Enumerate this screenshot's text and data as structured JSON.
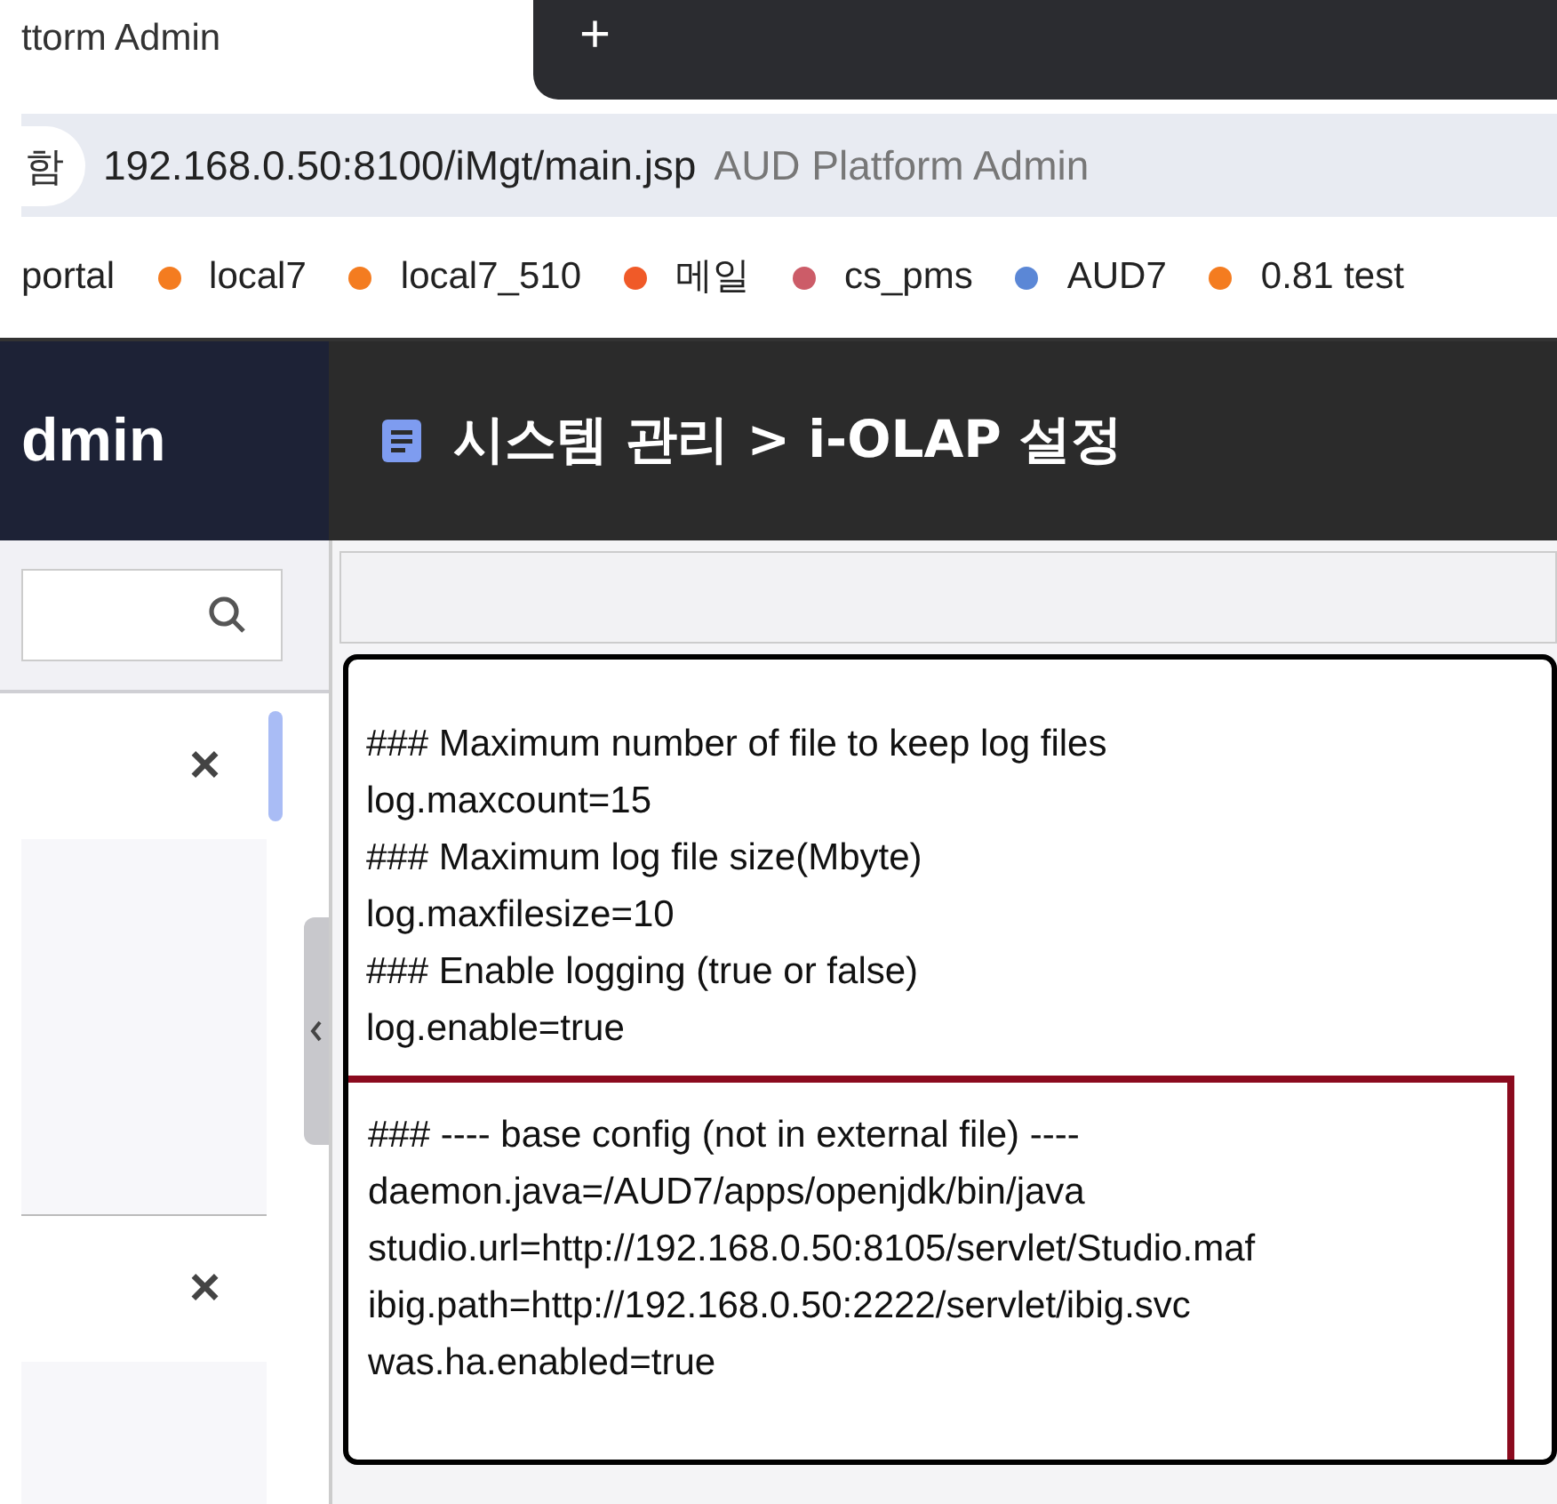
{
  "browser": {
    "tab_title": "ttorm Admin",
    "new_tab": "+",
    "address_prefix": "함",
    "url": "192.168.0.50:8100/iMgt/main.jsp",
    "page_title": "AUD Platform Admin",
    "bookmarks": [
      {
        "label": "portal"
      },
      {
        "label": "local7",
        "color": "#f47c20"
      },
      {
        "label": "local7_510",
        "color": "#f47c20"
      },
      {
        "label": "메일",
        "color": "#f05a28"
      },
      {
        "label": "cs_pms",
        "color": "#cc5c68"
      },
      {
        "label": "AUD7",
        "color": "#5b87d6"
      },
      {
        "label": "0.81 test",
        "color": "#f47c20"
      }
    ]
  },
  "app": {
    "brand": "dmin",
    "breadcrumb": "시스템 관리 > i-OLAP 설정"
  },
  "sidebar": {
    "items": [
      {
        "close": "×"
      },
      {
        "close": "×"
      }
    ]
  },
  "editor": {
    "groups": [
      {
        "highlighted": false,
        "lines": [
          "### Maximum number of file to keep log files",
          "log.maxcount=15",
          "### Maximum log file size(Mbyte)",
          "log.maxfilesize=10",
          "### Enable logging (true or false)",
          "log.enable=true"
        ]
      },
      {
        "highlighted": true,
        "lines": [
          "### ---- base config (not in external file) ----",
          "daemon.java=/AUD7/apps/openjdk/bin/java",
          "studio.url=http://192.168.0.50:8105/servlet/Studio.maf",
          "ibig.path=http://192.168.0.50:2222/servlet/ibig.svc",
          "was.ha.enabled=true"
        ]
      }
    ]
  }
}
